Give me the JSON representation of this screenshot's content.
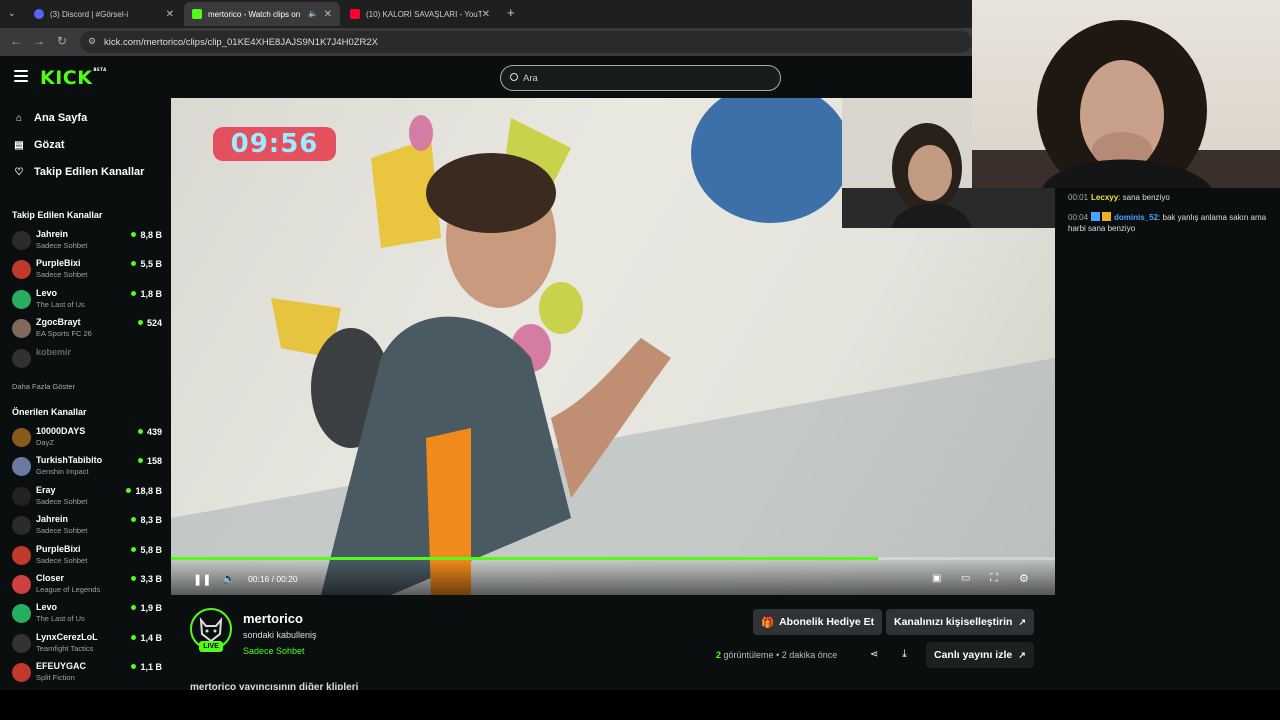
{
  "browser": {
    "tabs": [
      {
        "title": "(3) Discord | #Görsel-i",
        "favicon_color": "#5865f2",
        "active": false
      },
      {
        "title": "mertorico - Watch clips on",
        "favicon_color": "#53fc18",
        "active": true
      },
      {
        "title": "(10) KALORİ SAVAŞLARI - YouT",
        "favicon_color": "#ff0033",
        "active": false
      }
    ],
    "url": "kick.com/mertorico/clips/clip_01KE4XHE8JAJS9N1K7J4H0ZR2X"
  },
  "header": {
    "logo": "KICK",
    "logo_badge": "BETA",
    "search_placeholder": "Ara"
  },
  "sidebar": {
    "nav": [
      {
        "label": "Ana Sayfa",
        "icon": "home-icon"
      },
      {
        "label": "Gözat",
        "icon": "browse-icon"
      },
      {
        "label": "Takip Edilen Kanallar",
        "icon": "heart-icon"
      }
    ],
    "following_title": "Takip Edilen Kanallar",
    "following": [
      {
        "name": "Jahrein",
        "category": "Sadece Sohbet",
        "viewers": "8,8 B",
        "avatar_color": "#2b2b2b"
      },
      {
        "name": "PurpleBixi",
        "category": "Sadece Sohbet",
        "viewers": "5,5 B",
        "avatar_color": "#c0392b"
      },
      {
        "name": "Levo",
        "category": "The Last of Us",
        "viewers": "1,8 B",
        "avatar_color": "#27ae60"
      },
      {
        "name": "ZgocBrayt",
        "category": "EA Sports FC 26",
        "viewers": "524",
        "avatar_color": "#7f6a5a"
      },
      {
        "name": "kobemir",
        "category": "",
        "viewers": "",
        "avatar_color": "#666666"
      }
    ],
    "show_more": "Daha Fazla Göster",
    "recommended_title": "Önerilen Kanallar",
    "recommended": [
      {
        "name": "10000DAYS",
        "category": "DayZ",
        "viewers": "439",
        "avatar_color": "#8a5a1a"
      },
      {
        "name": "TurkishTabibito",
        "category": "Genshin Impact",
        "viewers": "158",
        "avatar_color": "#6a7aa0"
      },
      {
        "name": "Eray",
        "category": "Sadece Sohbet",
        "viewers": "18,8 B",
        "avatar_color": "#222222"
      },
      {
        "name": "Jahrein",
        "category": "Sadece Sohbet",
        "viewers": "8,3 B",
        "avatar_color": "#2b2b2b"
      },
      {
        "name": "PurpleBixi",
        "category": "Sadece Sohbet",
        "viewers": "5,8 B",
        "avatar_color": "#c0392b"
      },
      {
        "name": "Closer",
        "category": "League of Legends",
        "viewers": "3,3 B",
        "avatar_color": "#d04040"
      },
      {
        "name": "Levo",
        "category": "The Last of Us",
        "viewers": "1,9 B",
        "avatar_color": "#27ae60"
      },
      {
        "name": "LynxCerezLoL",
        "category": "Teamfight Tactics",
        "viewers": "1,4 B",
        "avatar_color": "#333333"
      },
      {
        "name": "EFEUYGAC",
        "category": "Split Fiction",
        "viewers": "1,1 B",
        "avatar_color": "#c0392b"
      }
    ]
  },
  "video": {
    "overlay_timer": "09:56",
    "timecode": "00:16 / 00:20",
    "progress": 0.8
  },
  "clip": {
    "channel": "mertorico",
    "title": "sondaki kabulleniş",
    "category": "Sadece Sohbet",
    "live_badge": "LIVE",
    "gift_button": "Abonelik Hediye Et",
    "customize_button": "Kanalınızı kişiselleştirin",
    "views_count": "2",
    "views_label": "görüntüleme",
    "time_ago": "2 dakika önce",
    "watch_live": "Canlı yayını izle",
    "more_clips": "mertorico yayıncısının diğer klipleri"
  },
  "chat": [
    {
      "time": "00:01",
      "user": "Lecxyy",
      "user_color": "#f0e040",
      "text": "sana benziyo"
    },
    {
      "time": "00:04",
      "user": "dominis_52",
      "user_color": "#4aa3ff",
      "text": "bak yanlış anlama sakın ama harbi sana benziyo"
    }
  ]
}
